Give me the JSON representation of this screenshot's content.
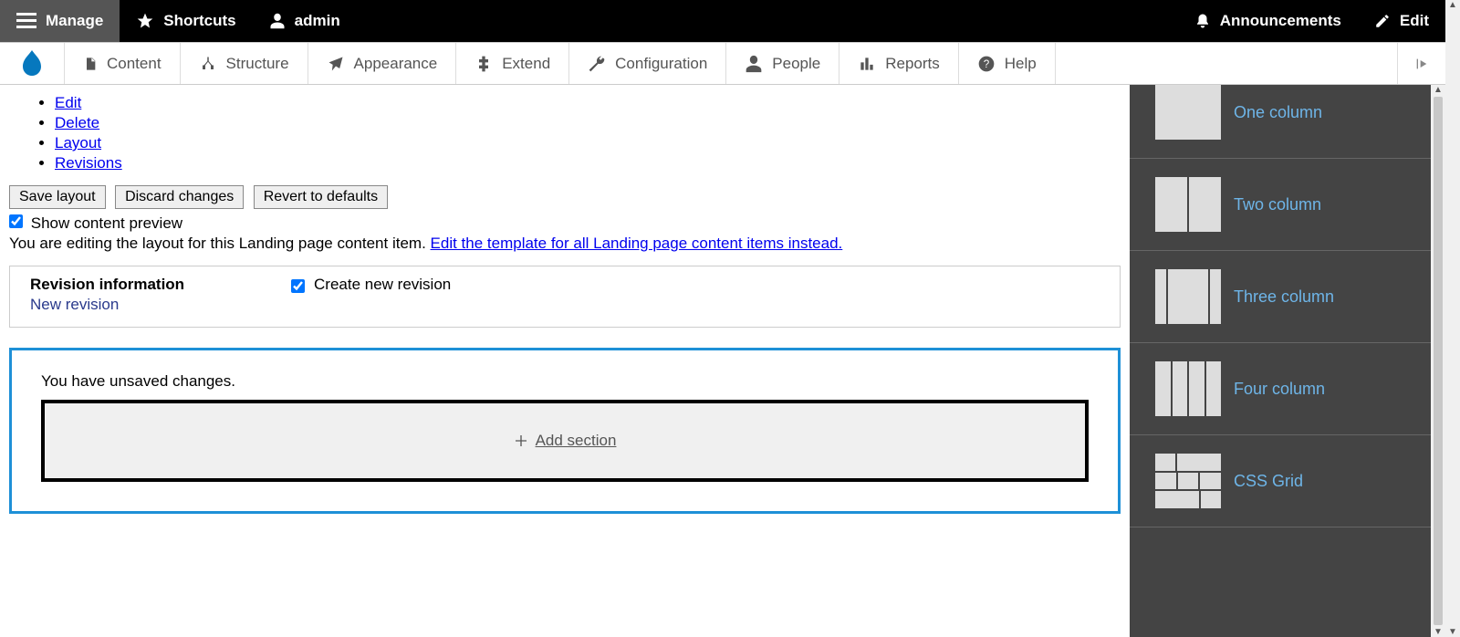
{
  "toolbar": {
    "manage": "Manage",
    "shortcuts": "Shortcuts",
    "user": "admin",
    "announcements": "Announcements",
    "edit": "Edit"
  },
  "admin_menu": {
    "items": [
      {
        "label": "Content"
      },
      {
        "label": "Structure"
      },
      {
        "label": "Appearance"
      },
      {
        "label": "Extend"
      },
      {
        "label": "Configuration"
      },
      {
        "label": "People"
      },
      {
        "label": "Reports"
      },
      {
        "label": "Help"
      }
    ]
  },
  "tabs": [
    "Edit",
    "Delete",
    "Layout",
    "Revisions"
  ],
  "buttons": {
    "save": "Save layout",
    "discard": "Discard changes",
    "revert": "Revert to defaults"
  },
  "preview": {
    "checked": true,
    "label": "Show content preview"
  },
  "edit_line": {
    "text": "You are editing the layout for this Landing page content item. ",
    "link": "Edit the template for all Landing page content items instead."
  },
  "revision": {
    "title": "Revision information",
    "sub": "New revision",
    "create_checked": true,
    "create_label": "Create new revision"
  },
  "layout_region": {
    "unsaved": "You have unsaved changes.",
    "add_section": "Add section"
  },
  "side_panel": {
    "layouts": [
      {
        "key": "one",
        "label": "One column"
      },
      {
        "key": "two",
        "label": "Two column"
      },
      {
        "key": "three",
        "label": "Three column"
      },
      {
        "key": "four",
        "label": "Four column"
      },
      {
        "key": "grid",
        "label": "CSS Grid"
      }
    ]
  }
}
